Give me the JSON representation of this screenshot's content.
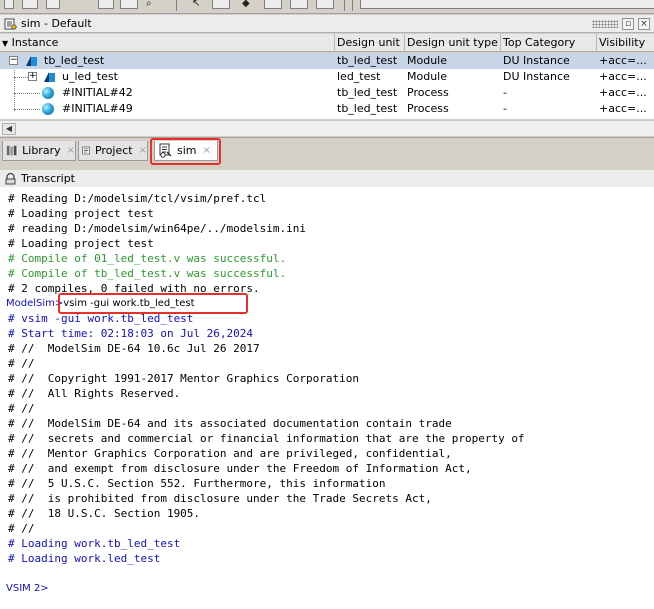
{
  "sim_pane": {
    "title": "sim - Default",
    "columns": [
      "Instance",
      "Design unit",
      "Design unit type",
      "Top Category",
      "Visibility"
    ],
    "rows": [
      {
        "instance": "tb_led_test",
        "design_unit": "tb_led_test",
        "unit_type": "Module",
        "top_category": "DU Instance",
        "visibility": "+acc=...",
        "icon": "module-icon",
        "expander": "−",
        "selected": true
      },
      {
        "instance": "u_led_test",
        "design_unit": "led_test",
        "unit_type": "Module",
        "top_category": "DU Instance",
        "visibility": "+acc=...",
        "icon": "module-icon",
        "expander": "+",
        "selected": false
      },
      {
        "instance": "#INITIAL#42",
        "design_unit": "tb_led_test",
        "unit_type": "Process",
        "top_category": "-",
        "visibility": "+acc=...",
        "icon": "process-icon",
        "expander": "",
        "selected": false
      },
      {
        "instance": "#INITIAL#49",
        "design_unit": "tb_led_test",
        "unit_type": "Process",
        "top_category": "-",
        "visibility": "+acc=...",
        "icon": "process-icon",
        "expander": "",
        "selected": false
      }
    ]
  },
  "tabs": [
    {
      "label": "Library",
      "icon": "library-icon",
      "close": "×",
      "active": false
    },
    {
      "label": "Project",
      "icon": "project-icon",
      "close": "×",
      "active": false
    },
    {
      "label": "sim",
      "icon": "sim-icon",
      "close": "×",
      "active": true
    }
  ],
  "transcript": {
    "title": "Transcript",
    "lines": [
      {
        "text": "# Reading D:/modelsim/tcl/vsim/pref.tcl",
        "kind": "comment"
      },
      {
        "text": "# Loading project test",
        "kind": "comment"
      },
      {
        "text": "# reading D:/modelsim/win64pe/../modelsim.ini",
        "kind": "comment"
      },
      {
        "text": "# Loading project test",
        "kind": "comment"
      },
      {
        "text": "# Compile of 01_led_test.v was successful.",
        "kind": "success"
      },
      {
        "text": "# Compile of tb_led_test.v was successful.",
        "kind": "success"
      },
      {
        "text": "# 2 compiles, 0 failed with no errors.",
        "kind": "comment"
      },
      {
        "text": "",
        "kind": "prompt",
        "prompt": "ModelSim>",
        "command": "vsim -gui work.tb_led_test"
      },
      {
        "text": "# vsim -gui work.tb_led_test",
        "kind": "info"
      },
      {
        "text": "# Start time: 02:18:03 on Jul 26,2024",
        "kind": "info"
      },
      {
        "text": "# //  ModelSim DE-64 10.6c Jul 26 2017",
        "kind": "comment"
      },
      {
        "text": "# //",
        "kind": "comment"
      },
      {
        "text": "# //  Copyright 1991-2017 Mentor Graphics Corporation",
        "kind": "comment"
      },
      {
        "text": "# //  All Rights Reserved.",
        "kind": "comment"
      },
      {
        "text": "# //",
        "kind": "comment"
      },
      {
        "text": "# //  ModelSim DE-64 and its associated documentation contain trade",
        "kind": "comment"
      },
      {
        "text": "# //  secrets and commercial or financial information that are the property of",
        "kind": "comment"
      },
      {
        "text": "# //  Mentor Graphics Corporation and are privileged, confidential,",
        "kind": "comment"
      },
      {
        "text": "# //  and exempt from disclosure under the Freedom of Information Act,",
        "kind": "comment"
      },
      {
        "text": "# //  5 U.S.C. Section 552. Furthermore, this information",
        "kind": "comment"
      },
      {
        "text": "# //  is prohibited from disclosure under the Trade Secrets Act,",
        "kind": "comment"
      },
      {
        "text": "# //  18 U.S.C. Section 1905.",
        "kind": "comment"
      },
      {
        "text": "# //",
        "kind": "comment"
      },
      {
        "text": "# Loading work.tb_led_test",
        "kind": "info"
      },
      {
        "text": "# Loading work.led_test",
        "kind": "info"
      },
      {
        "text": "",
        "kind": "blank"
      },
      {
        "text": "",
        "kind": "prompt",
        "prompt": "VSIM 2>",
        "command": ""
      }
    ]
  },
  "colors": {
    "success": "#2d9a2d",
    "info": "#1010c8",
    "highlight": "#e8302a",
    "selected_row": "#c7d5e6"
  }
}
